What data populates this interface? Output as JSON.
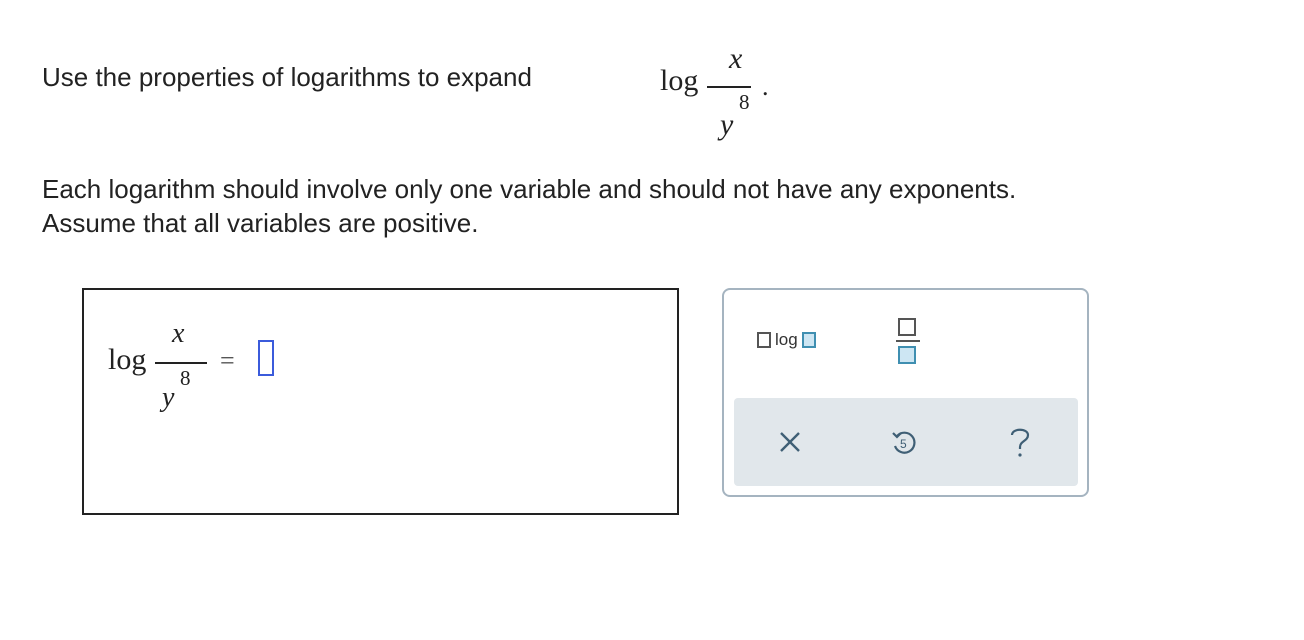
{
  "question": {
    "prompt": "Use the properties of logarithms to expand",
    "expression": {
      "log": "log",
      "numerator": "x",
      "denominator": "y",
      "exponent": "8",
      "period": "."
    },
    "instructions": [
      "Each logarithm should involve only one variable and should not have any exponents.",
      "Assume that all variables are positive."
    ]
  },
  "answer": {
    "log": "log",
    "numerator": "x",
    "denominator": "y",
    "exponent": "8",
    "equals": "="
  },
  "palette": {
    "log_template_label": "log",
    "buttons": {
      "clear": "×",
      "undo": "undo",
      "help": "?"
    }
  },
  "colors": {
    "slot_border": "#3b5bdb",
    "palette_border": "#a5b4c0",
    "toolbar_bg": "#e1e7eb",
    "accent_fill": "#cde6f3",
    "accent_border": "#3f8fb1",
    "icon_color": "#3f5f75"
  }
}
